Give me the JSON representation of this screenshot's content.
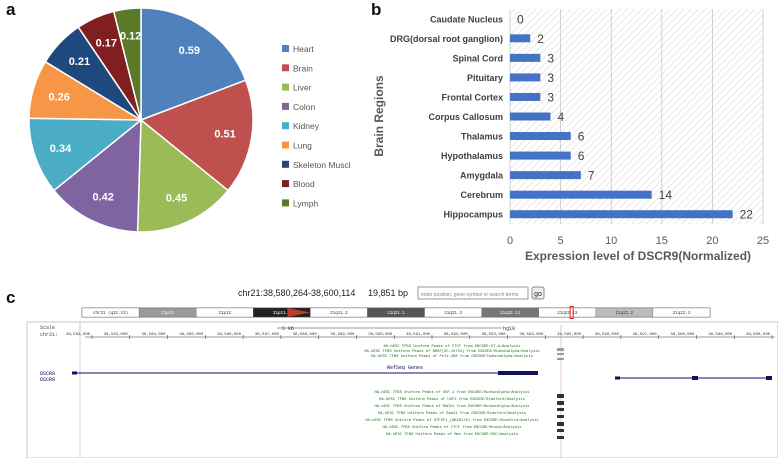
{
  "panel_labels": {
    "a": "a",
    "b": "b",
    "c": "c"
  },
  "chart_data": [
    {
      "type": "pie",
      "categories": [
        "Heart",
        "Brain",
        "Liver",
        "Colon",
        "Kidney",
        "Lung",
        "Skeleton Muscle",
        "Blood",
        "Lymph"
      ],
      "legend_labels": [
        "Heart",
        "Brain",
        "Liver",
        "Colon",
        "Kidney",
        "Lung",
        "Skeleton Muscl",
        "Blood",
        "Lymph"
      ],
      "values": [
        0.59,
        0.51,
        0.45,
        0.42,
        0.34,
        0.26,
        0.21,
        0.17,
        0.12
      ],
      "data_labels": [
        "0.59",
        "0.51",
        "0.45",
        "0.42",
        "0.34",
        "0.26",
        "0.21",
        "0.17",
        "0.12"
      ],
      "colors": [
        "#4f81bd",
        "#c0504d",
        "#9bbb59",
        "#8064a2",
        "#4bacc6",
        "#f79646",
        "#1f497d",
        "#7f1f1f",
        "#5a7a2a"
      ],
      "legend_position": "right"
    },
    {
      "type": "bar",
      "orientation": "horizontal",
      "categories": [
        "Caudate Nucleus",
        "DRG(dorsal root ganglion)",
        "Spinal Cord",
        "Pituitary",
        "Frontal Cortex",
        "Corpus Callosum",
        "Thalamus",
        "Hypothalamus",
        "Amygdala",
        "Cerebrum",
        "Hippocampus"
      ],
      "values": [
        0,
        2,
        3,
        3,
        3,
        4,
        6,
        6,
        7,
        14,
        22
      ],
      "data_labels": [
        "0",
        "2",
        "3",
        "3",
        "3",
        "4",
        "6",
        "6",
        "7",
        "14",
        "22"
      ],
      "xlabel": "Expression level of DSCR9(Normalized)",
      "ylabel": "Brain Regions",
      "xlim": [
        0,
        25
      ],
      "xticks": [
        0,
        5,
        10,
        15,
        20,
        25
      ],
      "xtick_labels": [
        "0",
        "5",
        "10",
        "15",
        "20",
        "25"
      ],
      "bar_color": "#4472c4",
      "grid": "hatched background"
    }
  ],
  "browser": {
    "position_text": "chr21:38,580,264-38,600,114",
    "size_text": "19,851 bp",
    "search_placeholder": "enter position, gene symbol or search terms",
    "go_label": "go",
    "scale_label": "Scale",
    "chrom_label": "chr21:",
    "scale_bar_label": "5 kb",
    "assembly_label": "hg19",
    "ruler_ticks": [
      "38,582,000",
      "38,583,000",
      "38,584,000",
      "38,585,000",
      "38,586,000",
      "38,587,000",
      "38,588,000",
      "38,589,000",
      "38,590,000",
      "38,591,000",
      "38,592,000",
      "38,593,000",
      "38,594,000",
      "38,595,000",
      "38,596,000",
      "38,597,000",
      "38,598,000",
      "38,599,000",
      "38,600,000"
    ],
    "gene_track_label": "RefSeq Genes",
    "gene_names": [
      "DSCR9",
      "DSCR9"
    ],
    "tfbs_tracks": [
      "HA-hESC TFBS Uniform Peaks of CTCF from ENCODE/UT-A/Analysis",
      "HA-hESC TFBS Uniform Peaks of NRSF(SC-15754) from ENCODE/HudsonAlpha/Analysis",
      "HA-hESC TFBS Uniform Peaks of Pol2-4H8 from ENCODE/HudsonAlpha/Analysis",
      "HA-hESC TFBS Uniform Peaks of USF-1 from ENCODE/HudsonAlpha/Analysis",
      "HA-hESC TFBS Uniform Peaks of USF2 from ENCODE/Stanford/Analysis",
      "HA-hESC TFBS Uniform Peaks of RAD21 from ENCODE/HudsonAlpha/Analysis",
      "HA-hESC TFBS Uniform Peaks of Rad21 from ENCODE/Stanford/Analysis",
      "HA-hESC TFBS Uniform Peaks of GTF2F1_(AB28179) from ENCODE/Stanford/Analysis",
      "HA-hESC TFBS Uniform Peaks of CTCF from ENCODE/Broad/Analysis",
      "HA-hESC TFBS Uniform Peaks of Max from ENCODE/USC/Analysis"
    ],
    "ideogram_bands": [
      "chr21 (q22.13)",
      "21p13",
      "21p12",
      "21p11.2",
      "21q11.2",
      "21q21.1",
      "21q21.3",
      "21q22.11",
      "21q22.13",
      "21q22.2",
      "21q22.3"
    ]
  }
}
